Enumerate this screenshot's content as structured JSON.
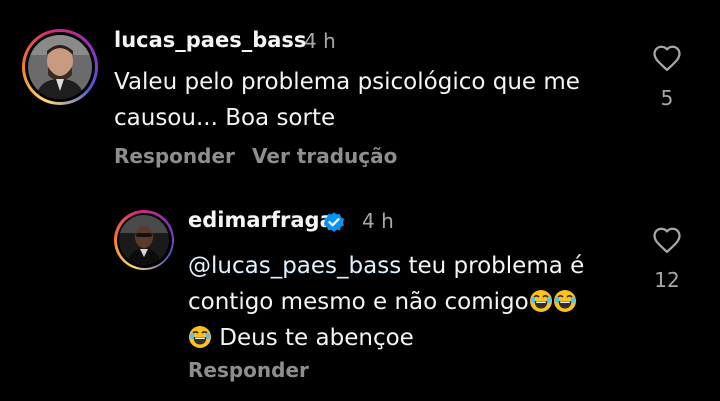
{
  "comments": [
    {
      "username": "lucas_paes_bass",
      "time": "4 h",
      "text": "Valeu pelo problema psicológico que me causou... Boa sorte",
      "likes": "5",
      "reply_label": "Responder",
      "translate_label": "Ver tradução",
      "icons": {
        "avatar": "user-avatar",
        "like": "heart-outline-icon"
      }
    },
    {
      "username": "edimarfraga",
      "verified": true,
      "time": "4 h",
      "mention": "@lucas_paes_bass",
      "text_line1_rest": " teu problema é",
      "text_line2": "contigo mesmo e não comigo",
      "text_line3": " Deus te abençoe",
      "emoji": "😂",
      "likes": "12",
      "reply_label": "Responder",
      "icons": {
        "avatar": "user-avatar",
        "like": "heart-outline-icon",
        "verified": "verified-badge-icon"
      }
    }
  ],
  "colors": {
    "background": "#000000",
    "primary_text": "#f5f5f5",
    "secondary_text": "#a8a8a8",
    "mention": "#e0f1ff",
    "verified": "#0095f6"
  }
}
